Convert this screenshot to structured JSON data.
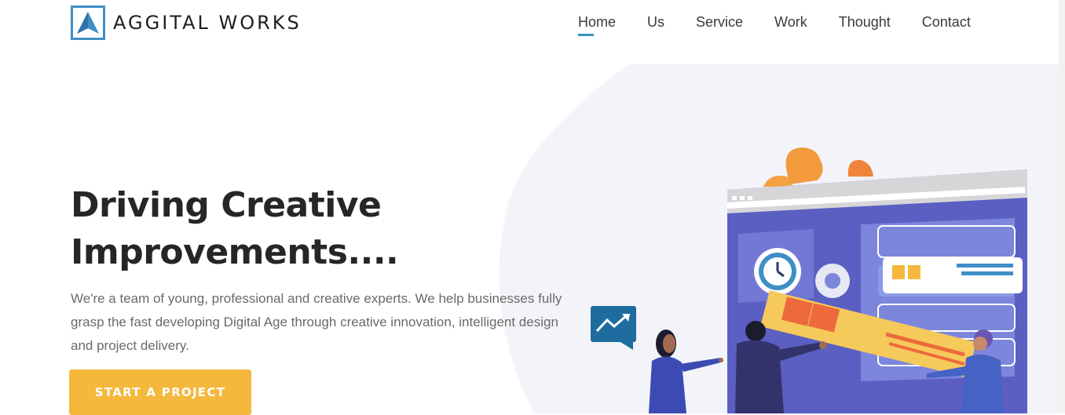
{
  "brand": {
    "name": "AGGITAL WORKS",
    "logo_icon": "triangle-a-logo-icon",
    "accent": "#3f8fc6"
  },
  "nav": {
    "items": [
      {
        "label": "Home",
        "active": true
      },
      {
        "label": "Us",
        "active": false
      },
      {
        "label": "Service",
        "active": false
      },
      {
        "label": "Work",
        "active": false
      },
      {
        "label": "Thought",
        "active": false
      },
      {
        "label": "Contact",
        "active": false
      }
    ]
  },
  "hero": {
    "title_line1": "Driving Creative",
    "title_line2": "Improvements....",
    "description": "We're a team of young, professional and creative experts. We help businesses fully grasp the fast developing Digital Age through creative innovation, intelligent design and project delivery.",
    "cta_label": "START A PROJECT",
    "cta_color": "#f5b83d",
    "illustration": "team-building-dashboard-illustration"
  }
}
